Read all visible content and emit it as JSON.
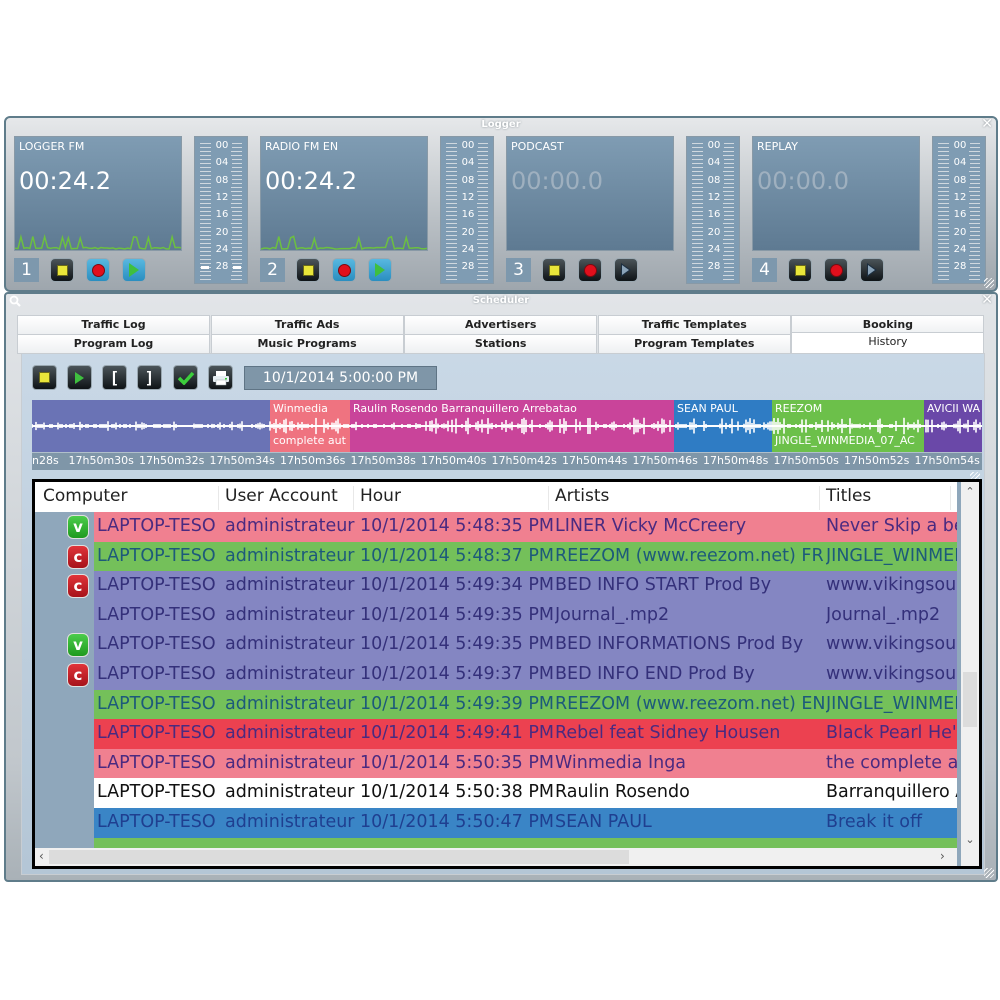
{
  "logger": {
    "title": "Logger",
    "close_icon": "close-icon",
    "meter_ticks": [
      "00",
      "04",
      "08",
      "12",
      "16",
      "20",
      "24",
      "28"
    ],
    "channels": [
      {
        "number": "1",
        "name": "LOGGER FM",
        "time": "00:24.2",
        "active": true,
        "play_color": "#3fbf3f"
      },
      {
        "number": "2",
        "name": "RADIO FM EN",
        "time": "00:24.2",
        "active": true,
        "play_color": "#3fbf3f"
      },
      {
        "number": "3",
        "name": "PODCAST",
        "time": "00:00.0",
        "active": false
      },
      {
        "number": "4",
        "name": "REPLAY",
        "time": "00:00.0",
        "active": false
      }
    ]
  },
  "scheduler": {
    "title": "Scheduler",
    "tabs_row1": [
      "Traffic Log",
      "Traffic Ads",
      "Advertisers",
      "Traffic Templates",
      "Booking"
    ],
    "tabs_row2": [
      "Program Log",
      "Music Programs",
      "Stations",
      "Program Templates",
      "History"
    ],
    "active_tab": "History",
    "toolbar": {
      "buttons": [
        "stop",
        "play",
        "mark-in",
        "mark-out",
        "validate",
        "print"
      ],
      "mark_in_glyph": "[",
      "mark_out_glyph": "]",
      "date_value": "10/1/2014 5:00:00 PM"
    },
    "timeline": {
      "segments": [
        {
          "label": "",
          "label2": "",
          "color": "#6a73b5"
        },
        {
          "label": "Winmedia",
          "label2": "complete aut",
          "color": "#ef7380"
        },
        {
          "label": "Raulin Rosendo Barranquillero Arrebatao",
          "label2": "",
          "color": "#c9449a"
        },
        {
          "label": "SEAN PAUL",
          "label2": "",
          "color": "#2f7cc4"
        },
        {
          "label": "REEZOM",
          "label2": "JINGLE_WINMEDIA_07_AC",
          "color": "#6cc04a"
        },
        {
          "label": "AVICII WA",
          "label2": "",
          "color": "#6a48a8"
        }
      ],
      "ticks": [
        "n28s",
        "17h50m30s",
        "17h50m32s",
        "17h50m34s",
        "17h50m36s",
        "17h50m38s",
        "17h50m40s",
        "17h50m42s",
        "17h50m44s",
        "17h50m46s",
        "17h50m48s",
        "17h50m50s",
        "17h50m52s",
        "17h50m54s"
      ]
    },
    "grid": {
      "columns": [
        "Computer",
        "User Account",
        "Hour",
        "Artists",
        "Titles"
      ],
      "rows": [
        {
          "badge": "v",
          "computer": "LAPTOP-TESO",
          "user": "administrateur",
          "hour": "10/1/2014 5:48:35 PM",
          "artist": "LINER Vicky McCreery",
          "title": "Never Skip a beat",
          "bg": "#f08090",
          "fg": "#4a2a80"
        },
        {
          "badge": "c",
          "computer": "LAPTOP-TESO",
          "user": "administrateur",
          "hour": "10/1/2014 5:48:37 PM",
          "artist": "REEZOM (www.reezom.net) FR",
          "title": "JINGLE_WINMEDIA",
          "bg": "#74c05a",
          "fg": "#1d5a7a"
        },
        {
          "badge": "c",
          "computer": "LAPTOP-TESO",
          "user": "administrateur",
          "hour": "10/1/2014 5:49:34 PM",
          "artist": "BED INFO START Prod By",
          "title": "www.vikingsound",
          "bg": "#8486c2",
          "fg": "#34307a"
        },
        {
          "badge": "",
          "computer": "LAPTOP-TESO",
          "user": "administrateur",
          "hour": "10/1/2014 5:49:35 PM",
          "artist": "Journal_.mp2",
          "title": "Journal_.mp2",
          "bg": "#8486c2",
          "fg": "#34307a"
        },
        {
          "badge": "v",
          "computer": "LAPTOP-TESO",
          "user": "administrateur",
          "hour": "10/1/2014 5:49:35 PM",
          "artist": "BED INFORMATIONS Prod By",
          "title": "www.vikingsound",
          "bg": "#8486c2",
          "fg": "#34307a"
        },
        {
          "badge": "c",
          "computer": "LAPTOP-TESO",
          "user": "administrateur",
          "hour": "10/1/2014 5:49:37 PM",
          "artist": "BED INFO END Prod By",
          "title": "www.vikingsound",
          "bg": "#8486c2",
          "fg": "#34307a"
        },
        {
          "badge": "",
          "computer": "LAPTOP-TESO",
          "user": "administrateur",
          "hour": "10/1/2014 5:49:39 PM",
          "artist": "REEZOM (www.reezom.net) EN",
          "title": "JINGLE_WINMEDIA",
          "bg": "#74c05a",
          "fg": "#1d5a7a"
        },
        {
          "badge": "",
          "computer": "LAPTOP-TESO",
          "user": "administrateur",
          "hour": "10/1/2014 5:49:41 PM",
          "artist": "Rebel feat Sidney Housen",
          "title": "Black Pearl He's a",
          "bg": "#ec4150",
          "fg": "#4a2a80"
        },
        {
          "badge": "",
          "computer": "LAPTOP-TESO",
          "user": "administrateur",
          "hour": "10/1/2014 5:50:35 PM",
          "artist": "Winmedia Inga",
          "title": "the complete aut",
          "bg": "#f08090",
          "fg": "#4a2a80"
        },
        {
          "badge": "",
          "computer": "LAPTOP-TESO",
          "user": "administrateur",
          "hour": "10/1/2014 5:50:38 PM",
          "artist": "Raulin Rosendo",
          "title": "Barranquillero Ar",
          "bg": "#ffffff",
          "fg": "#111111"
        },
        {
          "badge": "",
          "computer": "LAPTOP-TESO",
          "user": "administrateur",
          "hour": "10/1/2014 5:50:47 PM",
          "artist": "SEAN PAUL",
          "title": "Break it off",
          "bg": "#3a85c6",
          "fg": "#1f3f90"
        },
        {
          "badge": "",
          "computer": "",
          "user": "",
          "hour": "",
          "artist": "",
          "title": "",
          "bg": "#74c05a",
          "fg": "#1d5a7a"
        }
      ]
    }
  }
}
